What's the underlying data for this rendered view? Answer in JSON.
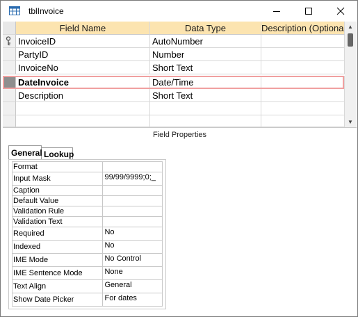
{
  "window": {
    "title": "tblInvoice"
  },
  "grid": {
    "headers": [
      "Field Name",
      "Data Type",
      "Description (Optional)"
    ],
    "rows": [
      {
        "name": "InvoiceID",
        "type": "AutoNumber",
        "primary_key": true
      },
      {
        "name": "PartyID",
        "type": "Number"
      },
      {
        "name": "InvoiceNo",
        "type": "Short Text"
      },
      {
        "name": "DateInvoice",
        "type": "Date/Time",
        "current": true
      },
      {
        "name": "Description",
        "type": "Short Text"
      }
    ]
  },
  "field_properties": {
    "label": "Field Properties",
    "tabs": [
      "General",
      "Lookup"
    ],
    "active_tab": "General",
    "rows": [
      {
        "key": "Format",
        "value": ""
      },
      {
        "key": "Input Mask",
        "value": "99/99/9999;0;_"
      },
      {
        "key": "Caption",
        "value": ""
      },
      {
        "key": "Default Value",
        "value": ""
      },
      {
        "key": "Validation Rule",
        "value": ""
      },
      {
        "key": "Validation Text",
        "value": ""
      },
      {
        "key": "Required",
        "value": "No"
      },
      {
        "key": "Indexed",
        "value": "No"
      },
      {
        "key": "IME Mode",
        "value": "No Control"
      },
      {
        "key": "IME Sentence Mode",
        "value": "None"
      },
      {
        "key": "Text Align",
        "value": "General"
      },
      {
        "key": "Show Date Picker",
        "value": "For dates"
      }
    ]
  },
  "icons": {
    "title": "table-icon",
    "key": "primary-key-icon"
  },
  "colors": {
    "header": "#fce4b0",
    "current_row_outline": "#f0a0a0"
  }
}
